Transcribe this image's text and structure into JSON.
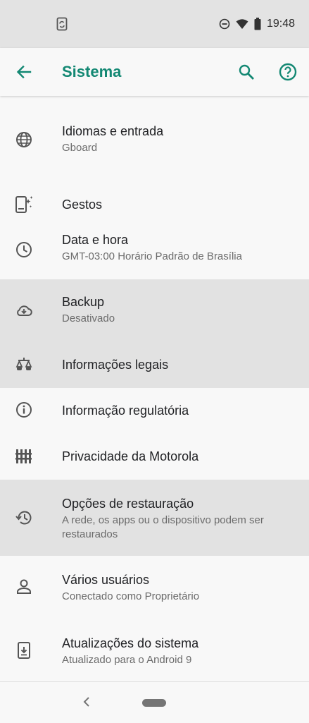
{
  "status_bar": {
    "time": "19:48",
    "left_icon": "phone-sync-icon",
    "right_icons": [
      "do-not-disturb-icon",
      "wifi-icon",
      "battery-icon"
    ]
  },
  "app_bar": {
    "title": "Sistema",
    "back_icon": "arrow-back-icon",
    "search_icon": "search-icon",
    "help_icon": "help-icon"
  },
  "colors": {
    "accent": "#138873",
    "highlight": "#e2e2e2",
    "background": "#f8f8f8"
  },
  "items": [
    {
      "title": "Idiomas e entrada",
      "subtitle": "Gboard",
      "icon": "globe-icon"
    },
    {
      "title": "Gestos",
      "subtitle": "",
      "icon": "gestures-phone-icon"
    },
    {
      "title": "Data e hora",
      "subtitle": "GMT-03:00 Horário Padrão de Brasília",
      "icon": "clock-icon"
    },
    {
      "title": "Backup",
      "subtitle": "Desativado",
      "icon": "cloud-backup-icon"
    },
    {
      "title": "Informações legais",
      "subtitle": "",
      "icon": "scales-icon"
    },
    {
      "title": "Informação regulatória",
      "subtitle": "",
      "icon": "info-icon"
    },
    {
      "title": "Privacidade da Motorola",
      "subtitle": "",
      "icon": "fence-icon"
    },
    {
      "title": "Opções de restauração",
      "subtitle": "A rede, os apps ou o dispositivo podem ser restaurados",
      "icon": "restore-icon"
    },
    {
      "title": "Vários usuários",
      "subtitle": "Conectado como Proprietário",
      "icon": "person-icon"
    },
    {
      "title": "Atualizações do sistema",
      "subtitle": "Atualizado para o Android 9",
      "icon": "system-update-icon"
    }
  ],
  "nav_bar": {
    "back_icon": "nav-back-icon",
    "home_icon": "nav-home-pill-icon"
  }
}
